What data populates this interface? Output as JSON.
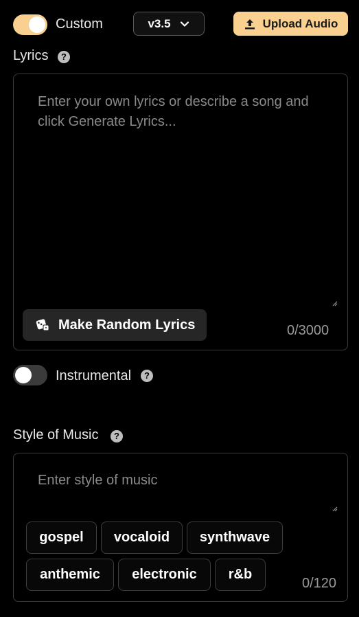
{
  "header": {
    "custom_toggle": {
      "label": "Custom",
      "on": true
    },
    "version": {
      "label": "v3.5"
    },
    "upload": {
      "label": "Upload Audio"
    }
  },
  "lyrics": {
    "title": "Lyrics",
    "placeholder": "Enter your own lyrics or describe a song and click Generate Lyrics...",
    "value": "",
    "random_button": "Make Random Lyrics",
    "counter": "0/3000"
  },
  "instrumental": {
    "label": "Instrumental",
    "on": false
  },
  "style": {
    "title": "Style of Music",
    "placeholder": "Enter style of music",
    "value": "",
    "counter": "0/120",
    "tags": [
      "gospel",
      "vocaloid",
      "synthwave",
      "anthemic",
      "electronic",
      "r&b"
    ]
  },
  "icons": {
    "help": "question-circle-icon",
    "upload": "upload-icon",
    "chevron": "chevron-down-icon",
    "dice": "dice-icon"
  },
  "colors": {
    "accent": "#f9d08f",
    "background": "#000000",
    "border": "#3a3a3a",
    "button_dark": "#262626"
  }
}
